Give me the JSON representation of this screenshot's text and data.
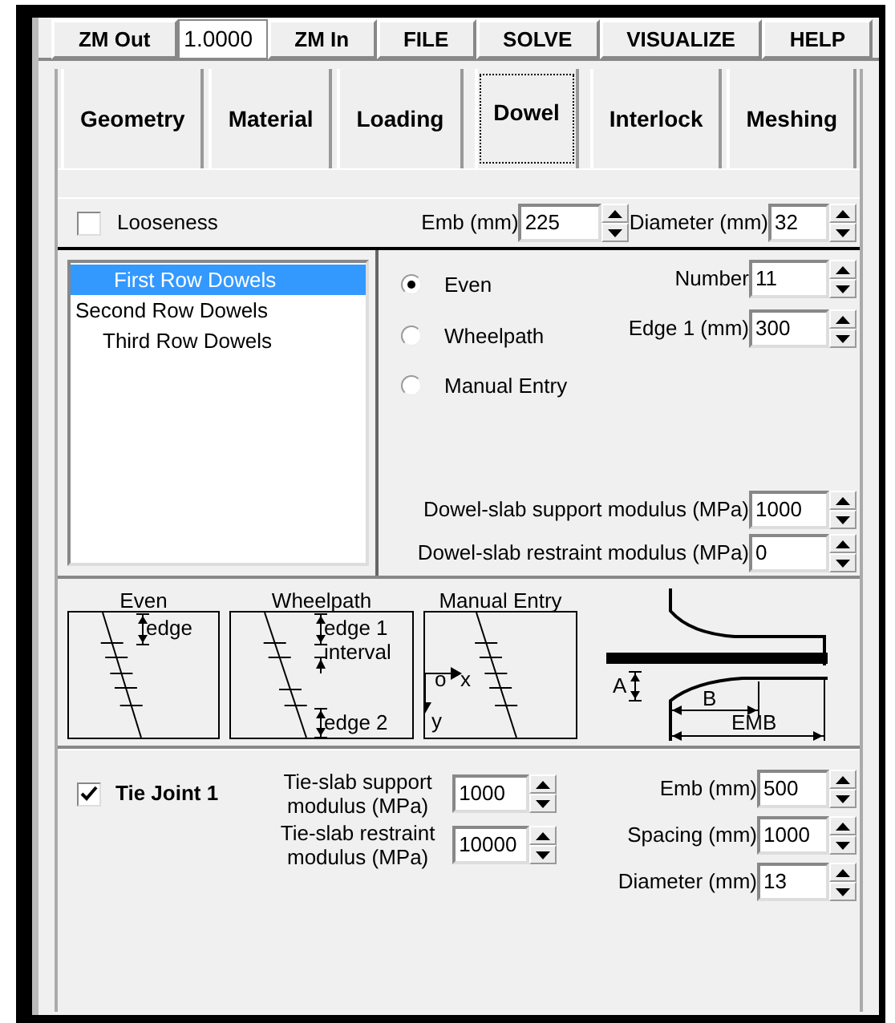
{
  "toolbar": [
    {
      "kind": "button",
      "label": "ZM Out"
    },
    {
      "kind": "field",
      "value": "1.0000"
    },
    {
      "kind": "button",
      "label": "ZM In"
    },
    {
      "kind": "button",
      "label": "FILE"
    },
    {
      "kind": "button",
      "label": "SOLVE"
    },
    {
      "kind": "button",
      "label": "VISUALIZE"
    },
    {
      "kind": "button",
      "label": "HELP"
    }
  ],
  "tabs": [
    {
      "label": "Geometry",
      "selected": false
    },
    {
      "label": "Material",
      "selected": false
    },
    {
      "label": "Loading",
      "selected": false
    },
    {
      "label": "Dowel",
      "selected": true
    },
    {
      "label": "Interlock",
      "selected": false
    },
    {
      "label": "Meshing",
      "selected": false
    }
  ],
  "looseness": {
    "label": "Looseness",
    "checked": false
  },
  "top_fields": [
    {
      "label": "Emb (mm)",
      "value": "225"
    },
    {
      "label": "Diameter (mm)",
      "value": "32"
    }
  ],
  "rows": [
    {
      "label": "First Row Dowels",
      "selected": true
    },
    {
      "label": "Second Row Dowels",
      "selected": false
    },
    {
      "label": "Third Row Dowels",
      "selected": false
    }
  ],
  "distribution": [
    {
      "label": "Even",
      "selected": true
    },
    {
      "label": "Wheelpath",
      "selected": false
    },
    {
      "label": "Manual Entry",
      "selected": false
    }
  ],
  "side_fields": [
    {
      "label": "Number",
      "value": "11"
    },
    {
      "label": "Edge 1 (mm)",
      "value": "300"
    }
  ],
  "moduli": [
    {
      "label": "Dowel-slab support modulus (MPa)",
      "value": "1000"
    },
    {
      "label": "Dowel-slab restraint modulus (MPa)",
      "value": "0"
    }
  ],
  "diagrams": {
    "even": {
      "title": "Even",
      "edge": "edge"
    },
    "wheelpath": {
      "title": "Wheelpath",
      "edge1": "edge 1",
      "interval": "interval",
      "edge2": "edge 2"
    },
    "manual": {
      "title": "Manual Entry",
      "origin": "o",
      "x": "x",
      "y": "y"
    },
    "section": {
      "a": "A",
      "b": "B",
      "emb": "EMB"
    }
  },
  "tie_joint": {
    "label": "Tie Joint 1",
    "checked": true,
    "moduli": [
      {
        "label": "Tie-slab support modulus (MPa)",
        "value": "1000"
      },
      {
        "label": "Tie-slab restraint modulus (MPa)",
        "value": "10000"
      }
    ],
    "fields": [
      {
        "label": "Emb (mm)",
        "value": "500"
      },
      {
        "label": "Spacing (mm)",
        "value": "1000"
      },
      {
        "label": "Diameter (mm)",
        "value": "13"
      }
    ]
  }
}
